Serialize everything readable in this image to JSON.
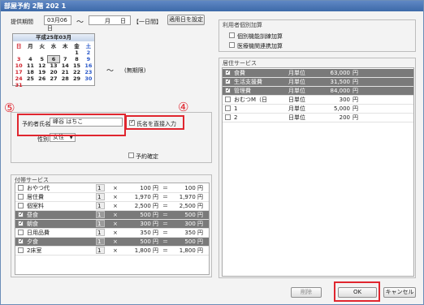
{
  "window": {
    "title": "部屋予約 2階 202 1"
  },
  "period": {
    "label": "提供期間",
    "start": "03月06日",
    "tilde": "～",
    "end_month": "月",
    "end_day": "日",
    "note": "【一日間】",
    "apply_label": "適用日を設定"
  },
  "calendar": {
    "title": "平成25年03月",
    "weekdays": [
      "日",
      "月",
      "火",
      "水",
      "木",
      "金",
      "土"
    ],
    "weeks": [
      [
        "",
        "",
        "",
        "",
        "",
        "1",
        "2"
      ],
      [
        "3",
        "4",
        "5",
        "6",
        "7",
        "8",
        "9"
      ],
      [
        "10",
        "11",
        "12",
        "13",
        "14",
        "15",
        "16"
      ],
      [
        "17",
        "18",
        "19",
        "20",
        "21",
        "22",
        "23"
      ],
      [
        "24",
        "25",
        "26",
        "27",
        "28",
        "29",
        "30"
      ],
      [
        "31",
        "",
        "",
        "",
        "",
        "",
        ""
      ]
    ],
    "selected_day": "6",
    "tilde": "～",
    "unlimited": "(無期限)"
  },
  "reserver": {
    "name_label": "予約者氏名",
    "name_value": "峰谷 はちこ",
    "direct_label": "氏名を直接入力",
    "gender_label": "性別",
    "gender_value": "女性",
    "confirm_label": "予約確定"
  },
  "annotations": {
    "five": "⑤",
    "four": "④"
  },
  "addon": {
    "title": "付帯サービス",
    "rows": [
      {
        "name": "おやつ代",
        "qty": "1",
        "x": "×",
        "price": "100 円",
        "eq": "＝",
        "total": "100 円",
        "checked": false,
        "selected": false
      },
      {
        "name": "居住費",
        "qty": "1",
        "x": "×",
        "price": "1,970 円",
        "eq": "＝",
        "total": "1,970 円",
        "checked": false,
        "selected": false
      },
      {
        "name": "個室料",
        "qty": "1",
        "x": "×",
        "price": "2,500 円",
        "eq": "＝",
        "total": "2,500 円",
        "checked": false,
        "selected": false
      },
      {
        "name": "昼食",
        "qty": "1",
        "x": "×",
        "price": "500 円",
        "eq": "＝",
        "total": "500 円",
        "checked": true,
        "selected": true
      },
      {
        "name": "朝食",
        "qty": "1",
        "x": "×",
        "price": "300 円",
        "eq": "＝",
        "total": "300 円",
        "checked": true,
        "selected": true
      },
      {
        "name": "日用品費",
        "qty": "1",
        "x": "×",
        "price": "350 円",
        "eq": "＝",
        "total": "350 円",
        "checked": false,
        "selected": false
      },
      {
        "name": "夕食",
        "qty": "1",
        "x": "×",
        "price": "500 円",
        "eq": "＝",
        "total": "500 円",
        "checked": true,
        "selected": true
      },
      {
        "name": "2床室",
        "qty": "1",
        "x": "×",
        "price": "1,800 円",
        "eq": "＝",
        "total": "1,800 円",
        "checked": false,
        "selected": false
      }
    ]
  },
  "user_addon": {
    "title": "利用者個別加算",
    "items": [
      "個別機能訓練加算",
      "医療機関連携加算"
    ]
  },
  "living": {
    "title": "居住サービス",
    "rows": [
      {
        "name": "食費",
        "unit": "月単位",
        "price": "63,000",
        "yen": "円",
        "checked": true,
        "selected": true
      },
      {
        "name": "生活支援費",
        "unit": "月単位",
        "price": "31,500",
        "yen": "円",
        "checked": true,
        "selected": true
      },
      {
        "name": "管理費",
        "unit": "月単位",
        "price": "84,000",
        "yen": "円",
        "checked": true,
        "selected": true
      },
      {
        "name": "おむつM（日",
        "unit": "日単位",
        "price": "300",
        "yen": "円",
        "checked": false,
        "selected": false
      },
      {
        "name": "1",
        "unit": "月単位",
        "price": "5,000",
        "yen": "円",
        "checked": false,
        "selected": false
      },
      {
        "name": "2",
        "unit": "日単位",
        "price": "200",
        "yen": "円",
        "checked": false,
        "selected": false
      }
    ]
  },
  "footer": {
    "delete_label": "削除",
    "ok_label": "OK",
    "cancel_label": "キャンセル"
  }
}
